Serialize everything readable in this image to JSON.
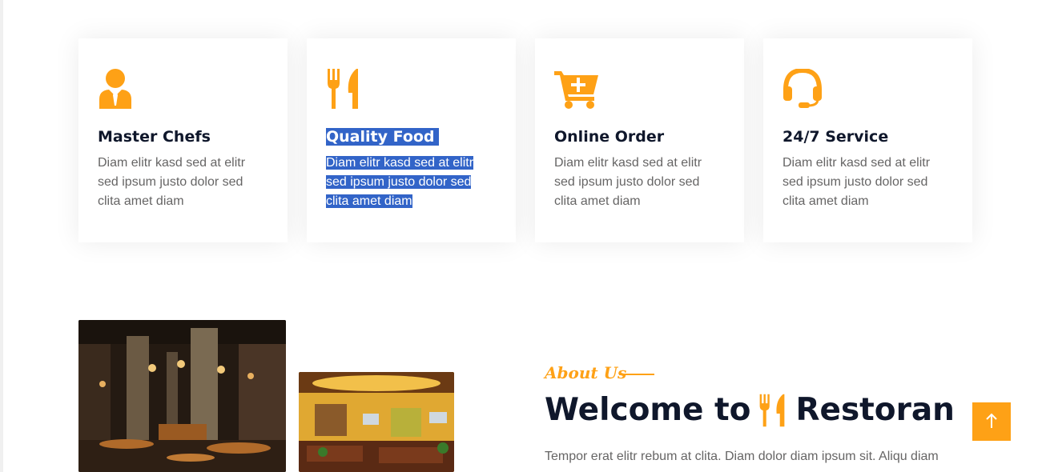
{
  "services": [
    {
      "icon": "chef-icon",
      "title": "Master Chefs",
      "desc": "Diam elitr kasd sed at elitr sed ipsum justo dolor sed clita amet diam"
    },
    {
      "icon": "utensils-icon",
      "title": "Quality Food",
      "desc": "Diam elitr kasd sed at elitr sed ipsum justo dolor sed clita amet diam"
    },
    {
      "icon": "cart-plus-icon",
      "title": "Online Order",
      "desc": "Diam elitr kasd sed at elitr sed ipsum justo dolor sed clita amet diam"
    },
    {
      "icon": "headset-icon",
      "title": "24/7 Service",
      "desc": "Diam elitr kasd sed at elitr sed ipsum justo dolor sed clita amet diam"
    }
  ],
  "about": {
    "subtitle": "About Us",
    "title_prefix": "Welcome to",
    "title_brand": "Restoran",
    "text": "Tempor erat elitr rebum at clita. Diam dolor diam ipsum sit. Aliqu diam"
  },
  "colors": {
    "accent": "#fea116",
    "dark": "#0f172b",
    "selection": "#3264c8",
    "body_text": "#666565"
  },
  "back_to_top": {
    "icon": "arrow-up-icon"
  }
}
